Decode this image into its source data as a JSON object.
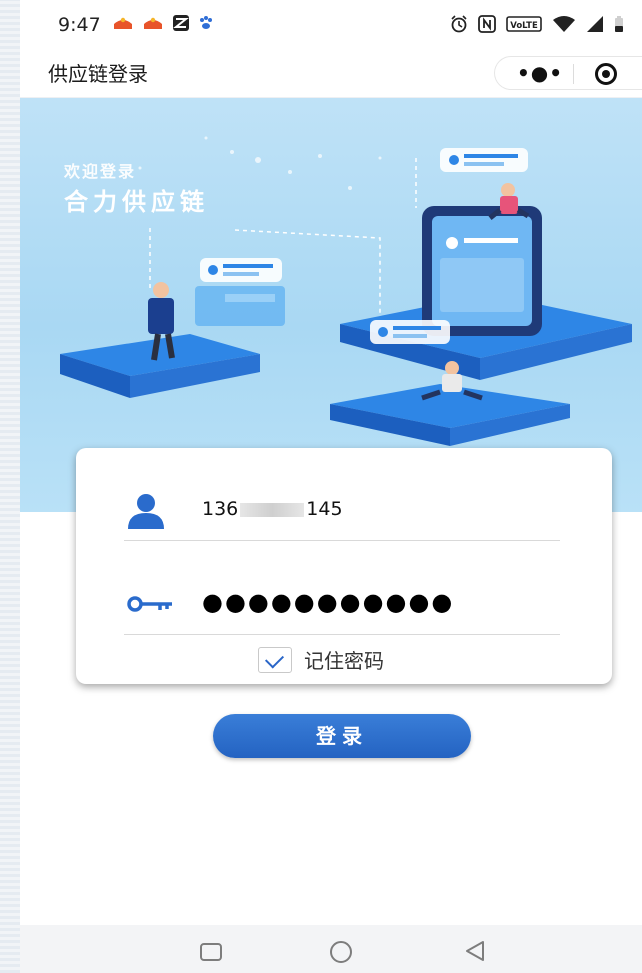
{
  "status_bar": {
    "time": "9:47",
    "right_icons": [
      "alarm-icon",
      "nfc-icon",
      "volte-icon",
      "wifi-icon",
      "signal-icon",
      "battery-icon"
    ],
    "left_icons": [
      "app-notification-icon",
      "app-notification-icon",
      "app-icon",
      "baidu-icon"
    ],
    "volte_label": "VoLTE"
  },
  "header": {
    "title": "供应链登录",
    "more_icon": "more-dots-icon",
    "close_icon": "target-icon"
  },
  "banner": {
    "welcome": "欢迎登录",
    "slogan": "合力供应链"
  },
  "form": {
    "phone_prefix": "136",
    "phone_suffix": "145",
    "password_masked": "●●●●●●●●●●●",
    "remember_label": "记住密码",
    "remember_checked": true,
    "login_label": "登录"
  },
  "colors": {
    "accent": "#2a6bcc",
    "banner_bg": "#b3dcf5"
  },
  "nav_bar": {
    "icons": [
      "recent-apps-icon",
      "home-icon",
      "back-icon"
    ]
  }
}
